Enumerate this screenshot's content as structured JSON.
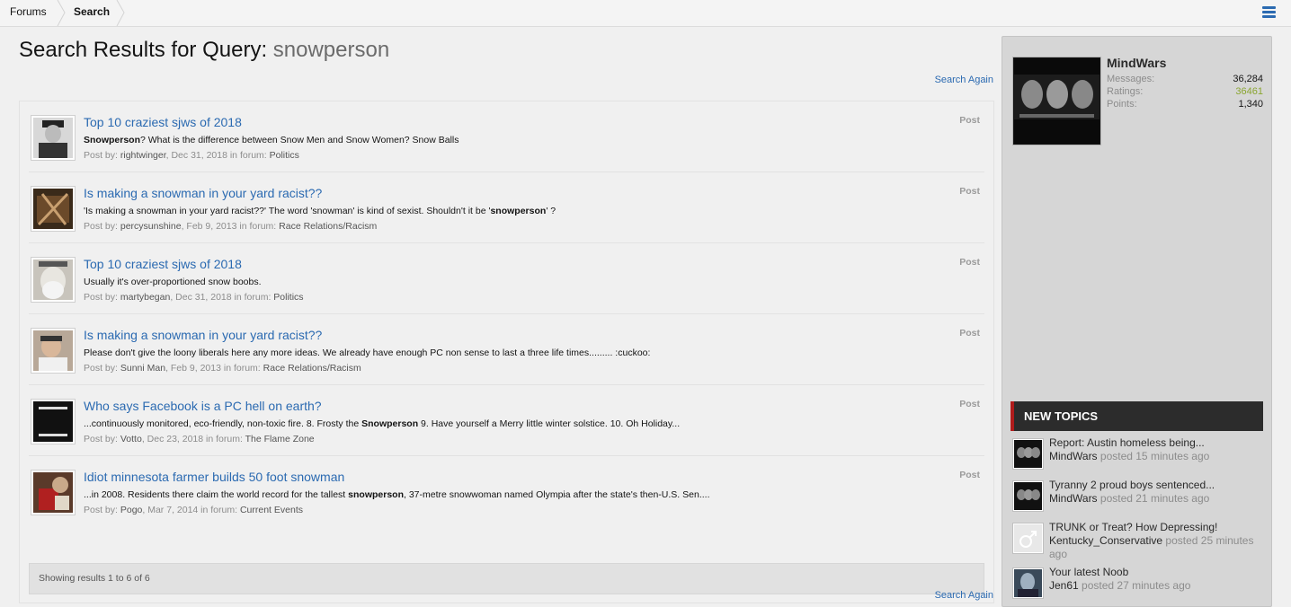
{
  "breadcrumb": {
    "forums": "Forums",
    "search": "Search"
  },
  "colors": {
    "link": "#2b6ab1",
    "accent_red": "#b01c1c",
    "ratings_green": "#8aa530"
  },
  "main": {
    "title_prefix": "Search Results for Query:",
    "title_query": "snowperson",
    "search_again": "Search Again",
    "results": [
      {
        "title": "Top 10 craziest sjws of 2018",
        "snippet_pre": "",
        "snippet_bold": "Snowperson",
        "snippet_post": "? What is the difference between Snow Men and Snow Women? Snow Balls",
        "meta_prefix": "Post by:",
        "author": "rightwinger",
        "date": ", Dec 31, 2018 in forum:",
        "forum": "Politics",
        "type": "Post"
      },
      {
        "title": "Is making a snowman in your yard racist??",
        "snippet_pre": "'Is making a snowman in your yard racist??' The word 'snowman' is kind of sexist. Shouldn't it be '",
        "snippet_bold": "snowperson",
        "snippet_post": "' ?",
        "meta_prefix": "Post by:",
        "author": "percysunshine",
        "date": ", Feb 9, 2013 in forum:",
        "forum": "Race Relations/Racism",
        "type": "Post"
      },
      {
        "title": "Top 10 craziest sjws of 2018",
        "snippet_pre": "Usually it's over-proportioned snow boobs.",
        "snippet_bold": "",
        "snippet_post": "",
        "meta_prefix": "Post by:",
        "author": "martybegan",
        "date": ", Dec 31, 2018 in forum:",
        "forum": "Politics",
        "type": "Post"
      },
      {
        "title": "Is making a snowman in your yard racist??",
        "snippet_pre": "Please don't give the loony liberals here any more ideas. We already have enough PC non sense to last a three life times......... :cuckoo:",
        "snippet_bold": "",
        "snippet_post": "",
        "meta_prefix": "Post by:",
        "author": "Sunni Man",
        "date": ", Feb 9, 2013 in forum:",
        "forum": "Race Relations/Racism",
        "type": "Post"
      },
      {
        "title": "Who says Facebook is a PC hell on earth?",
        "snippet_pre": "...continuously monitored, eco-friendly, non-toxic fire. 8. Frosty the ",
        "snippet_bold": "Snowperson",
        "snippet_post": " 9. Have yourself a Merry little winter solstice. 10. Oh Holiday...",
        "meta_prefix": "Post by:",
        "author": "Votto",
        "date": ", Dec 23, 2018 in forum:",
        "forum": "The Flame Zone",
        "type": "Post"
      },
      {
        "title": "Idiot minnesota farmer builds 50 foot snowman",
        "snippet_pre": "...in 2008. Residents there claim the world record for the tallest ",
        "snippet_bold": "snowperson",
        "snippet_post": ", 37-metre snowwoman named Olympia after the state's then-U.S. Sen....",
        "meta_prefix": "Post by:",
        "author": "Pogo",
        "date": ", Mar 7, 2014 in forum:",
        "forum": "Current Events",
        "type": "Post"
      }
    ],
    "pager_text": "Showing results 1 to 6 of 6"
  },
  "sidebar": {
    "profile": {
      "name": "MindWars",
      "messages_label": "Messages:",
      "messages": "36,284",
      "ratings_label": "Ratings:",
      "ratings": "36461",
      "points_label": "Points:",
      "points": "1,340"
    },
    "new_topics_header": "NEW TOPICS",
    "new_topics": [
      {
        "title": "Report: Austin homeless being...",
        "user": "MindWars",
        "posted": " posted 15 minutes ago"
      },
      {
        "title": "Tyranny 2 proud boys sentenced...",
        "user": "MindWars",
        "posted": " posted 21 minutes ago"
      },
      {
        "title": "TRUNK or Treat? How Depressing!",
        "user": "Kentucky_Conservative",
        "posted": " posted 25 minutes ago"
      },
      {
        "title": "Your latest Noob",
        "user": "Jen61",
        "posted": " posted 27 minutes ago"
      }
    ]
  }
}
